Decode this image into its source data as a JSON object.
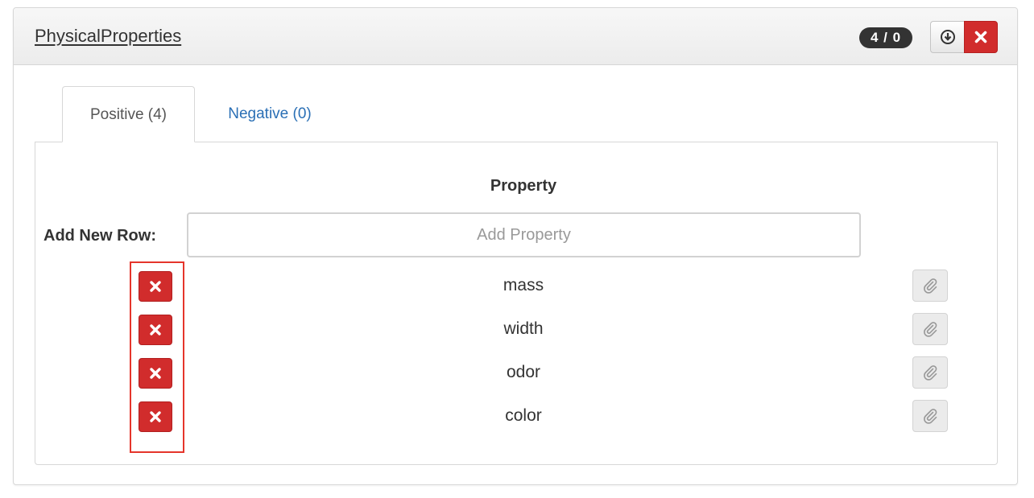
{
  "panel": {
    "title": "PhysicalProperties",
    "count_badge": "4 / 0",
    "download_icon": "download-circle-icon",
    "close_icon": "close-icon"
  },
  "tabs": [
    {
      "label": "Positive (4)",
      "active": true
    },
    {
      "label": "Negative (0)",
      "active": false
    }
  ],
  "table": {
    "column_header": "Property",
    "add_row_label": "Add New Row:",
    "add_placeholder": "Add Property",
    "add_value": "",
    "rows": [
      {
        "property": "mass"
      },
      {
        "property": "width"
      },
      {
        "property": "odor"
      },
      {
        "property": "color"
      }
    ],
    "delete_icon": "close-icon",
    "attach_icon": "paperclip-icon"
  },
  "colors": {
    "danger": "#d12c2c",
    "link": "#2a6fb5",
    "badge": "#333333",
    "highlight": "#e5352b"
  }
}
